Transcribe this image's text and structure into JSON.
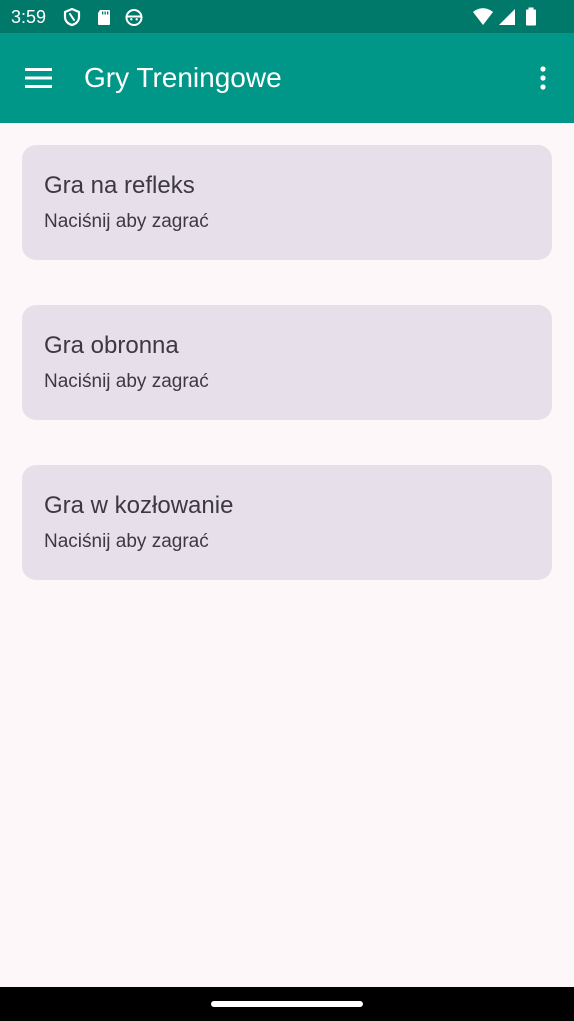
{
  "status_bar": {
    "time": "3:59",
    "left_icons": [
      "shield-icon",
      "sd-card-icon",
      "robot-face-icon"
    ],
    "right_icons": [
      "wifi-icon",
      "signal-icon",
      "battery-icon"
    ]
  },
  "app_bar": {
    "title": "Gry Treningowe",
    "menu_icon": "hamburger-menu-icon",
    "overflow_icon": "more-vert-icon"
  },
  "games": [
    {
      "title": "Gra na refleks",
      "subtitle": "Naciśnij aby zagrać"
    },
    {
      "title": "Gra obronna",
      "subtitle": "Naciśnij aby zagrać"
    },
    {
      "title": "Gra w kozłowanie",
      "subtitle": "Naciśnij aby zagrać"
    }
  ],
  "colors": {
    "status_bar": "#00796B",
    "app_bar": "#009688",
    "background": "#FEF7FA",
    "card": "#E7E0EB",
    "card_text": "#3C3940"
  }
}
